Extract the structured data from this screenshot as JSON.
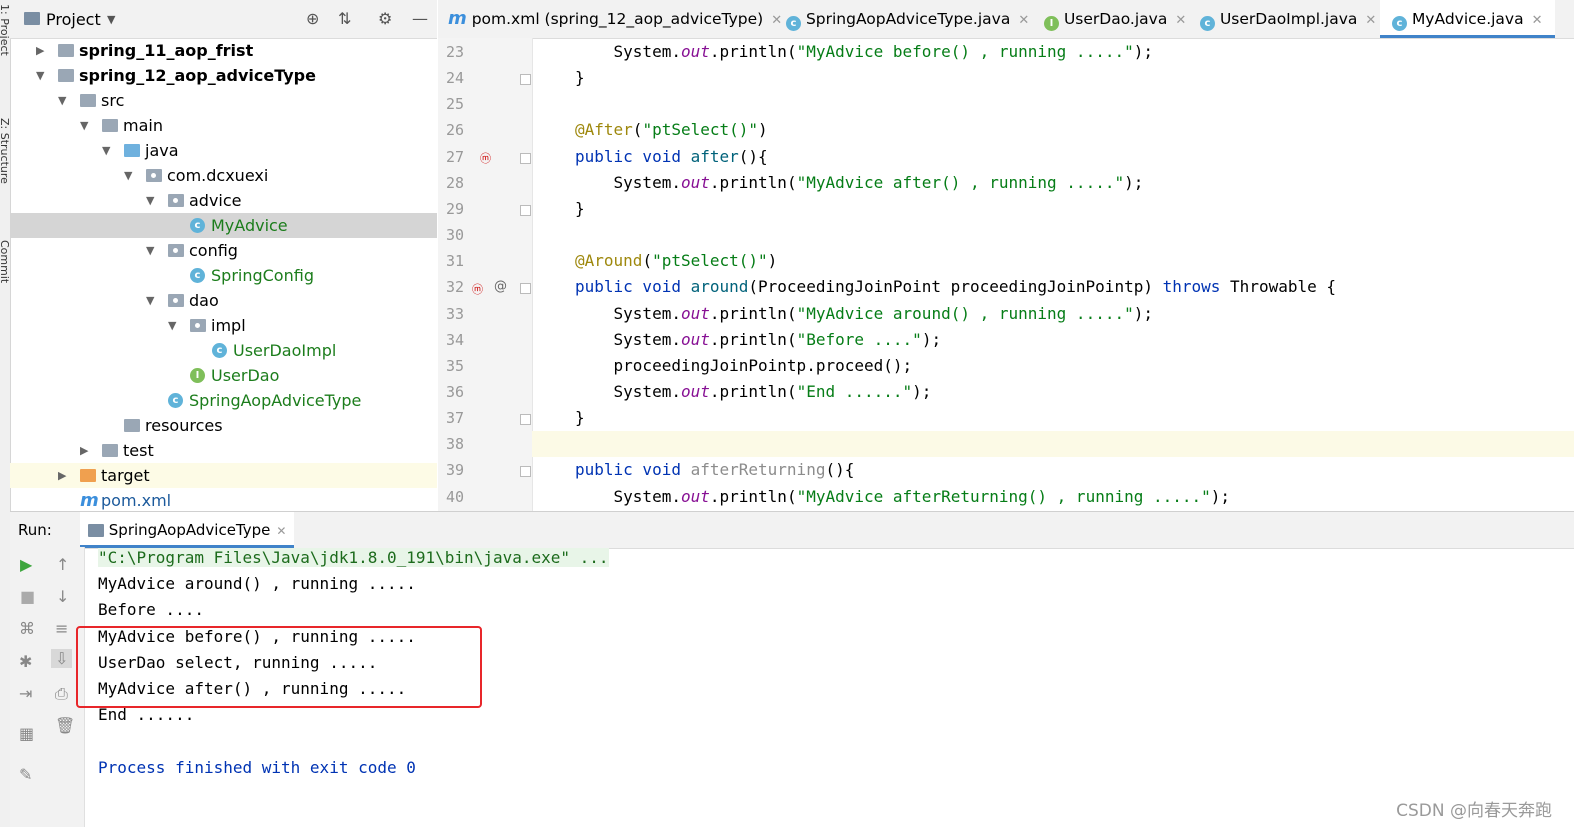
{
  "strip": {
    "labels": [
      "1: Project",
      "Z: Structure",
      "Commit"
    ]
  },
  "project_panel": {
    "title": "Project",
    "tree": [
      {
        "label": "spring_11_aop_frist",
        "kind": "module",
        "depth": 0,
        "expanded": false,
        "bold": true
      },
      {
        "label": "spring_12_aop_adviceType",
        "kind": "module",
        "depth": 0,
        "expanded": true,
        "bold": true
      },
      {
        "label": "src",
        "kind": "folder",
        "depth": 1,
        "expanded": true
      },
      {
        "label": "main",
        "kind": "folder",
        "depth": 2,
        "expanded": true
      },
      {
        "label": "java",
        "kind": "source-folder",
        "depth": 3,
        "expanded": true
      },
      {
        "label": "com.dcxuexi",
        "kind": "package",
        "depth": 4,
        "expanded": true
      },
      {
        "label": "advice",
        "kind": "package",
        "depth": 5,
        "expanded": true
      },
      {
        "label": "MyAdvice",
        "kind": "class",
        "depth": 6,
        "selected": true
      },
      {
        "label": "config",
        "kind": "package",
        "depth": 5,
        "expanded": true
      },
      {
        "label": "SpringConfig",
        "kind": "class",
        "depth": 6
      },
      {
        "label": "dao",
        "kind": "package",
        "depth": 5,
        "expanded": true
      },
      {
        "label": "impl",
        "kind": "package",
        "depth": 6,
        "expanded": true
      },
      {
        "label": "UserDaoImpl",
        "kind": "class",
        "depth": 7
      },
      {
        "label": "UserDao",
        "kind": "interface",
        "depth": 6
      },
      {
        "label": "SpringAopAdviceType",
        "kind": "main-class",
        "depth": 5
      },
      {
        "label": "resources",
        "kind": "folder",
        "depth": 3
      },
      {
        "label": "test",
        "kind": "folder",
        "depth": 2,
        "expanded": false
      },
      {
        "label": "target",
        "kind": "target-folder",
        "depth": 1,
        "expanded": false
      },
      {
        "label": "pom.xml",
        "kind": "maven",
        "depth": 1
      }
    ]
  },
  "tabs": [
    {
      "label": "pom.xml (spring_12_aop_adviceType)",
      "icon": "maven-icon"
    },
    {
      "label": "SpringAopAdviceType.java",
      "icon": "class-icon"
    },
    {
      "label": "UserDao.java",
      "icon": "interface-icon"
    },
    {
      "label": "UserDaoImpl.java",
      "icon": "class-icon"
    },
    {
      "label": "MyAdvice.java",
      "icon": "class-icon",
      "active": true
    }
  ],
  "editor": {
    "line_numbers": [
      "23",
      "24",
      "25",
      "26",
      "27",
      "28",
      "29",
      "30",
      "31",
      "32",
      "33",
      "34",
      "35",
      "36",
      "37",
      "38",
      "39",
      "40"
    ],
    "lines": [
      [
        {
          "t": "    System."
        },
        {
          "t": "out",
          "c": "it"
        },
        {
          "t": ".println("
        },
        {
          "t": "\"MyAdvice before() , running .....\"",
          "c": "st"
        },
        {
          "t": ");"
        }
      ],
      [
        {
          "t": "}"
        }
      ],
      [
        {
          "t": ""
        }
      ],
      [
        {
          "t": "@After",
          "c": "an"
        },
        {
          "t": "("
        },
        {
          "t": "\"ptSelect()\"",
          "c": "st"
        },
        {
          "t": ")"
        }
      ],
      [
        {
          "t": "public void ",
          "c": "kw"
        },
        {
          "t": "after",
          "c": "fnm"
        },
        {
          "t": "(){"
        }
      ],
      [
        {
          "t": "    System."
        },
        {
          "t": "out",
          "c": "it"
        },
        {
          "t": ".println("
        },
        {
          "t": "\"MyAdvice after() , running .....\"",
          "c": "st"
        },
        {
          "t": ");"
        }
      ],
      [
        {
          "t": "}"
        }
      ],
      [
        {
          "t": ""
        }
      ],
      [
        {
          "t": "@Around",
          "c": "an"
        },
        {
          "t": "("
        },
        {
          "t": "\"ptSelect()\"",
          "c": "st"
        },
        {
          "t": ")"
        }
      ],
      [
        {
          "t": "public void ",
          "c": "kw"
        },
        {
          "t": "around",
          "c": "fnm"
        },
        {
          "t": "(ProceedingJoinPoint proceedingJoinPointp) "
        },
        {
          "t": "throws ",
          "c": "kw"
        },
        {
          "t": "Throwable {"
        }
      ],
      [
        {
          "t": "    System."
        },
        {
          "t": "out",
          "c": "it"
        },
        {
          "t": ".println("
        },
        {
          "t": "\"MyAdvice around() , running .....\"",
          "c": "st"
        },
        {
          "t": ");"
        }
      ],
      [
        {
          "t": "    System."
        },
        {
          "t": "out",
          "c": "it"
        },
        {
          "t": ".println("
        },
        {
          "t": "\"Before ....\"",
          "c": "st"
        },
        {
          "t": ");"
        }
      ],
      [
        {
          "t": "    proceedingJoinPointp.proceed();"
        }
      ],
      [
        {
          "t": "    System."
        },
        {
          "t": "out",
          "c": "it"
        },
        {
          "t": ".println("
        },
        {
          "t": "\"End ......\"",
          "c": "st"
        },
        {
          "t": ");"
        }
      ],
      [
        {
          "t": "}"
        }
      ],
      [
        {
          "t": ""
        }
      ],
      [
        {
          "t": "public void ",
          "c": "kw"
        },
        {
          "t": "afterReturning",
          "c": "gr"
        },
        {
          "t": "(){"
        }
      ],
      [
        {
          "t": "    System."
        },
        {
          "t": "out",
          "c": "it"
        },
        {
          "t": ".println("
        },
        {
          "t": "\"MyAdvice afterReturning() , running .....\"",
          "c": "st"
        },
        {
          "t": ");"
        }
      ]
    ]
  },
  "run_panel": {
    "run_label": "Run:",
    "tab_label": "SpringAopAdviceType",
    "output": [
      "\"C:\\Program Files\\Java\\jdk1.8.0_191\\bin\\java.exe\" ...",
      "MyAdvice around() , running .....",
      "Before ....",
      "MyAdvice before() , running .....",
      "UserDao select, running .....",
      "MyAdvice after() , running .....",
      "End ......",
      "",
      "Process finished with exit code 0"
    ]
  },
  "watermark": "CSDN @向春天奔跑"
}
